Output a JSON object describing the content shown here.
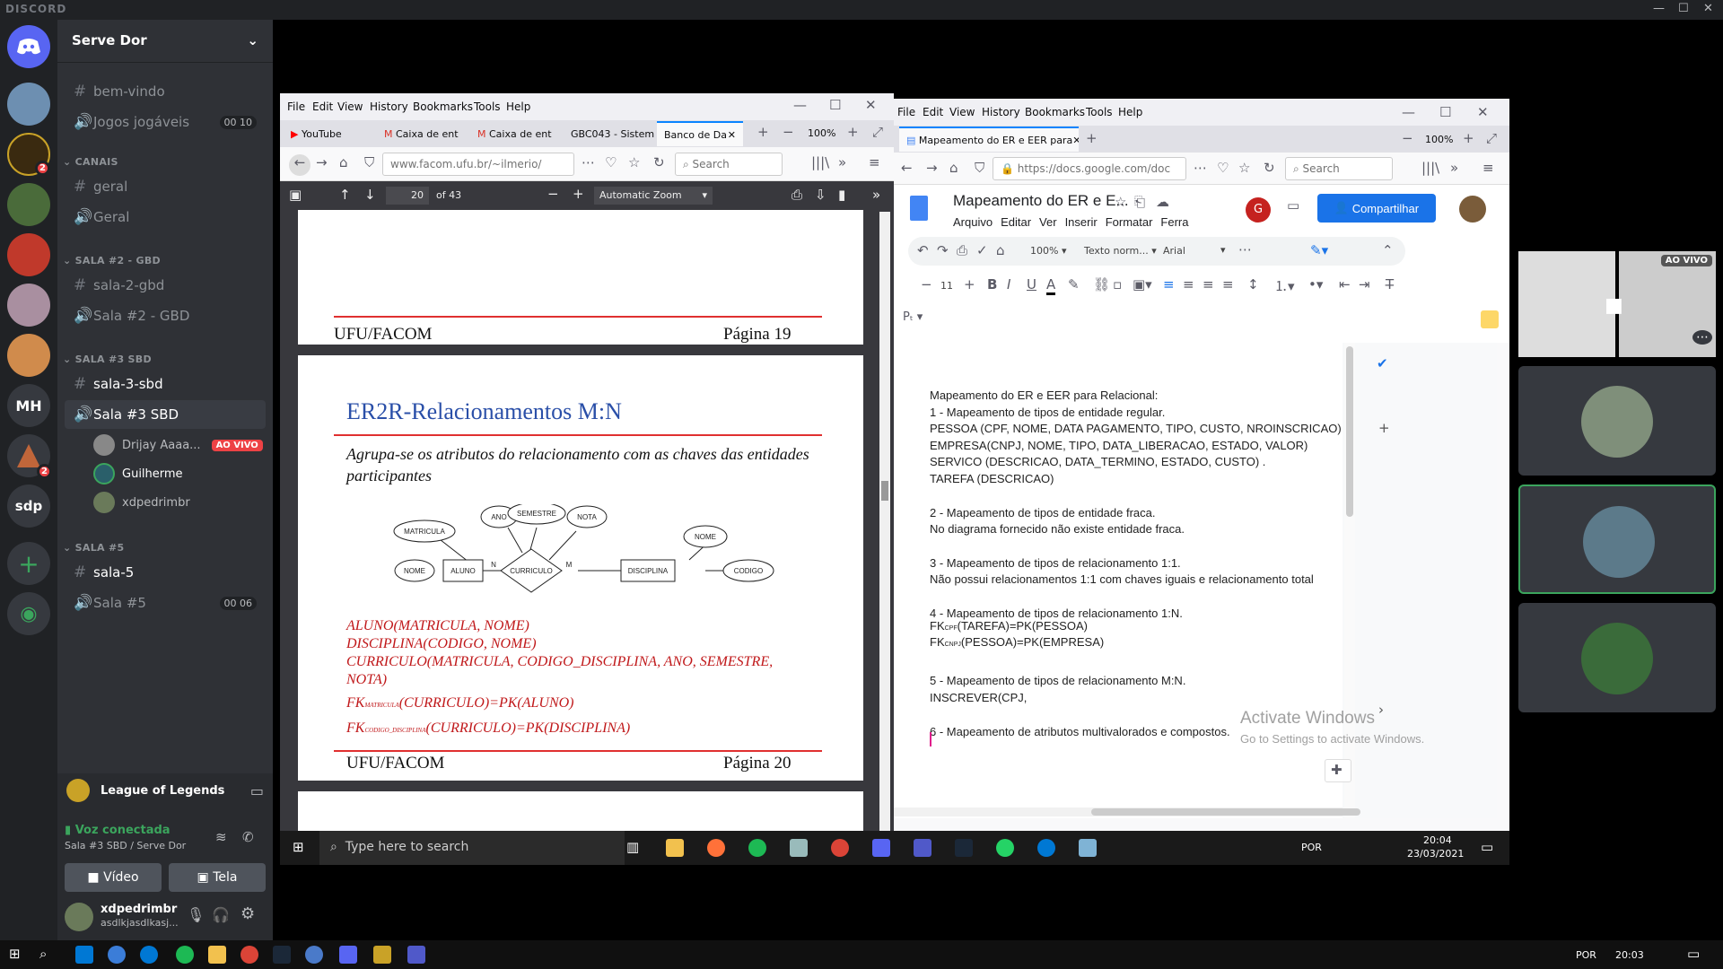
{
  "discord": {
    "brand": "DISCORD",
    "server_name": "Serve Dor",
    "rail": [
      {
        "label": "",
        "badge": ""
      },
      {
        "label": "",
        "badge": "2"
      },
      {
        "label": "",
        "badge": ""
      },
      {
        "label": "",
        "badge": ""
      },
      {
        "label": "",
        "badge": ""
      },
      {
        "label": "",
        "badge": ""
      },
      {
        "label": "MH",
        "badge": ""
      },
      {
        "label": "",
        "badge": "2"
      },
      {
        "label": "sdp",
        "badge": ""
      }
    ],
    "channels_top": [
      {
        "sym": "#",
        "name": "bem-vindo"
      },
      {
        "sym": "🔊",
        "name": "Jogos jogáveis",
        "count": "00",
        "count2": "10"
      }
    ],
    "cat1": "CANAIS",
    "canais": [
      {
        "sym": "#",
        "name": "geral"
      },
      {
        "sym": "🔊",
        "name": "Geral"
      }
    ],
    "cat2": "SALA #2 - GBD",
    "sala2": [
      {
        "sym": "#",
        "name": "sala-2-gbd"
      },
      {
        "sym": "🔊",
        "name": "Sala #2 - GBD"
      }
    ],
    "cat3": "SALA #3 SBD",
    "sala3": [
      {
        "sym": "#",
        "name": "sala-3-sbd"
      },
      {
        "sym": "🔊",
        "name": "Sala #3 SBD"
      }
    ],
    "voice_users": [
      {
        "name": "Drijay Aaaa...",
        "live": "AO VIVO"
      },
      {
        "name": "Guilherme"
      },
      {
        "name": "xdpedrimbr"
      }
    ],
    "cat5": "SALA #5",
    "sala5": [
      {
        "sym": "#",
        "name": "sala-5"
      },
      {
        "sym": "🔊",
        "name": "Sala #5",
        "count": "00",
        "count2": "06"
      }
    ],
    "activity": "League of Legends",
    "voice_status": "Voz conectada",
    "voice_channel": "Sala #3 SBD / Serve Dor",
    "video_btn": "Vídeo",
    "screen_btn": "Tela",
    "username": "xdpedrimbr",
    "user_status": "asdlkjasdlkasj...",
    "live_tag": "AO VIVO"
  },
  "firefox_left": {
    "menu": [
      "File",
      "Edit",
      "View",
      "History",
      "Bookmarks",
      "Tools",
      "Help"
    ],
    "tabs": [
      "YouTube",
      "Caixa de ent",
      "Caixa de ent",
      "GBC043 - Sistem",
      "Banco de Da"
    ],
    "zoom": "100%",
    "url": "www.facom.ufu.br/~ilmerio/",
    "search": "Search",
    "page": "20",
    "of_pages": "of 43",
    "zoom_select": "Automatic Zoom"
  },
  "pdf": {
    "footer_left": "UFU/FACOM",
    "footer_p19": "Página 19",
    "title": "ER2R-Relacionamentos M:N",
    "subtitle": "Agrupa-se os atributos do relacionamento com as chaves das entidades participantes",
    "diagram": {
      "ano": "ANO",
      "semestre": "SEMESTRE",
      "nota": "NOTA",
      "matricula": "MATRICULA",
      "nome1": "NOME",
      "aluno": "ALUNO",
      "curriculo": "CURRICULO",
      "disciplina": "DISCIPLINA",
      "nome2": "NOME",
      "codigo": "CODIGO",
      "n": "N",
      "m": "M"
    },
    "lines": [
      "ALUNO(MATRICULA, NOME)",
      "DISCIPLINA(CODIGO, NOME)",
      "CURRICULO(MATRICULA, CODIGO_DISCIPLINA, ANO, SEMESTRE,",
      "NOTA)"
    ],
    "fk1_pre": "FK",
    "fk1_sub": "MATRICULA",
    "fk1_post": "(CURRICULO)=PK(ALUNO)",
    "fk2_pre": "FK",
    "fk2_sub": "CODIGO_DISCIPLINA",
    "fk2_post": "(CURRICULO)=PK(DISCIPLINA)",
    "footer_p20": "Página 20"
  },
  "firefox_right": {
    "menu": [
      "File",
      "Edit",
      "View",
      "History",
      "Bookmarks",
      "Tools",
      "Help"
    ],
    "tab": "Mapeamento do ER e EER para",
    "zoom": "100%",
    "url": "https://docs.google.com/doc",
    "search": "Search"
  },
  "gdoc": {
    "title": "Mapeamento do ER e E...",
    "menu": [
      "Arquivo",
      "Editar",
      "Ver",
      "Inserir",
      "Formatar",
      "Ferra"
    ],
    "avatar_letter": "G",
    "share": "Compartilhar",
    "zoom": "100%",
    "style": "Texto norm...",
    "font": "Arial",
    "size": "11",
    "body": [
      "Mapeamento do ER e EER para Relacional:",
      "1 - Mapeamento de tipos de entidade regular.",
      "PESSOA  (CPF, NOME, DATA PAGAMENTO, TIPO, CUSTO, NROINSCRICAO)",
      "EMPRESA(CNPJ, NOME, TIPO, DATA_LIBERACAO, ESTADO, VALOR)",
      "SERVICO (DESCRICAO, DATA_TERMINO, ESTADO, CUSTO) .",
      "TAREFA  (DESCRICAO)",
      "",
      "2 - Mapeamento de tipos de entidade fraca.",
      "No diagrama fornecido não existe entidade fraca.",
      "",
      "3 - Mapeamento de tipos de relacionamento 1:1.",
      "Não possui relacionamentos 1:1 com chaves iguais e relacionamento total",
      "",
      "4 - Mapeamento de tipos de relacionamento 1:N.",
      "",
      "",
      "",
      "5 - Mapeamento de tipos de relacionamento M:N.",
      "INSCREVER(CPJ,",
      "",
      "6 - Mapeamento de atributos multivalorados e compostos."
    ],
    "fk_a_pre": "FK",
    "fk_a_sub": "CPF",
    "fk_a_post": "(TAREFA)=PK(PESSOA)",
    "fk_b_pre": "FK",
    "fk_b_sub": "CNPJ",
    "fk_b_post": "(PESSOA)=PK(EMPRESA)",
    "activate1": "Activate Windows",
    "activate2": "Go to Settings to activate Windows."
  },
  "inner_taskbar": {
    "search": "Type here to search",
    "lang": "POR",
    "time": "20:04",
    "date": "23/03/2021"
  },
  "outer_taskbar": {
    "lang": "POR",
    "time": "20:03"
  },
  "colors": {
    "discord_bg": "#2f3136",
    "accent": "#5865f2",
    "share_blue": "#1a73e8",
    "live_red": "#ed4245",
    "green": "#3ba55d"
  }
}
